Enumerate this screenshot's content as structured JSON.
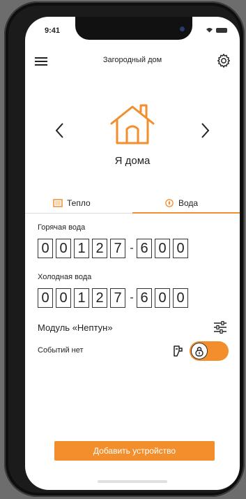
{
  "status": {
    "time": "9:41"
  },
  "header": {
    "title": "Загородный дом"
  },
  "mode": {
    "label": "Я дома"
  },
  "tabs": [
    {
      "label": "Тепло",
      "active": false
    },
    {
      "label": "Вода",
      "active": true
    }
  ],
  "hot_water": {
    "label": "Горячая вода",
    "digits_left": [
      "0",
      "0",
      "1",
      "2",
      "7"
    ],
    "separator": "-",
    "digits_right": [
      "6",
      "0",
      "0"
    ]
  },
  "cold_water": {
    "label": "Холодная вода",
    "digits_left": [
      "0",
      "0",
      "1",
      "2",
      "7"
    ],
    "separator": "-",
    "digits_right": [
      "6",
      "0",
      "0"
    ]
  },
  "module": {
    "title": "Модуль «Нептун»",
    "events": "Событий нет"
  },
  "actions": {
    "add_device": "Добавить устройство"
  },
  "colors": {
    "accent": "#f28e2b",
    "text": "#222222"
  }
}
